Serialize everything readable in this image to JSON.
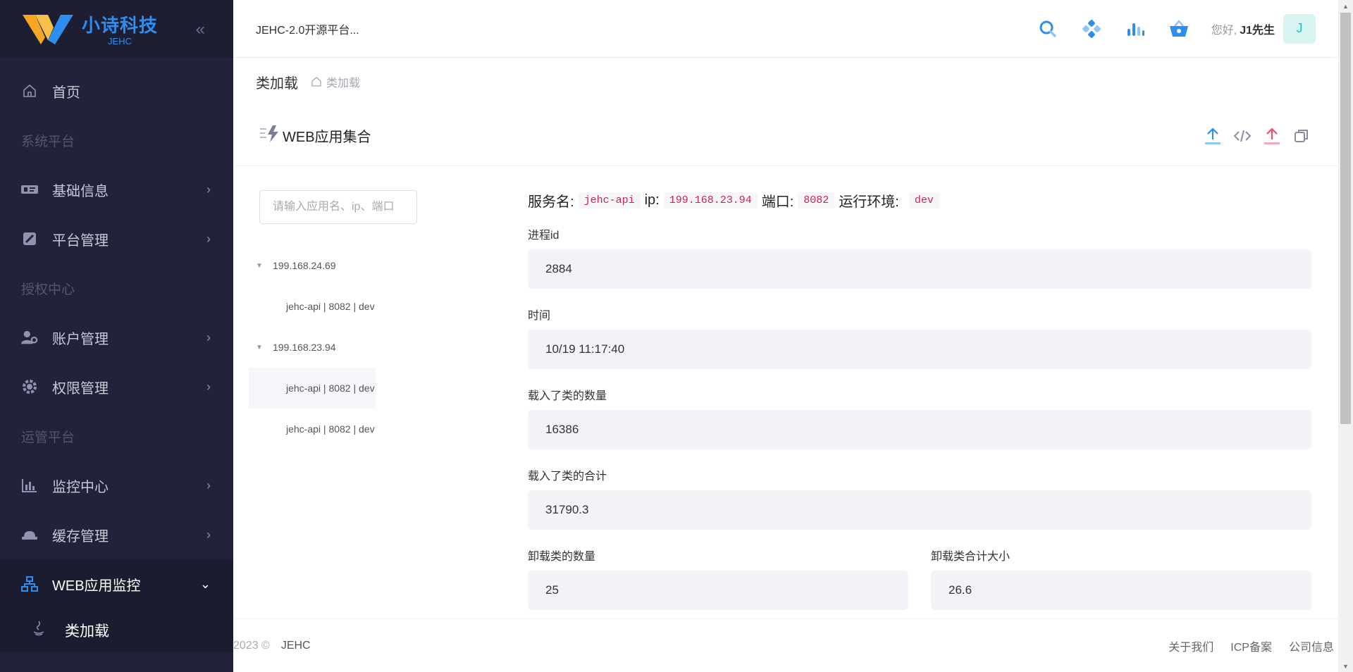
{
  "sidebar": {
    "logo": {
      "title": "小诗科技",
      "subtitle": "JEHC"
    },
    "home": "首页",
    "sections": {
      "system": "系统平台",
      "auth": "授权中心",
      "ops": "运管平台"
    },
    "items": {
      "basic": "基础信息",
      "platform": "平台管理",
      "account": "账户管理",
      "permission": "权限管理",
      "monitor": "监控中心",
      "cache": "缓存管理",
      "webapp": "WEB应用监控",
      "classload": "类加载"
    }
  },
  "header": {
    "title": "JEHC-2.0开源平台...",
    "greeting": "您好,",
    "username": "J1先生",
    "avatar": "J"
  },
  "breadcrumb": {
    "title": "类加载",
    "crumb": "类加载"
  },
  "card": {
    "title": "WEB应用集合",
    "search_placeholder": "请输入应用名、ip、端口",
    "tree": [
      {
        "label": "199.168.24.69",
        "children": [
          "jehc-api | 8082 | dev"
        ]
      },
      {
        "label": "199.168.23.94",
        "children": [
          "jehc-api | 8082 | dev",
          "jehc-api | 8082 | dev"
        ]
      }
    ]
  },
  "detail": {
    "service_label": "服务名:",
    "service": "jehc-api",
    "ip_label": "ip:",
    "ip": "199.168.23.94",
    "port_label": "端口:",
    "port": "8082",
    "env_label": "运行环境:",
    "env": "dev",
    "fields": {
      "pid_label": "进程id",
      "pid": "2884",
      "time_label": "时间",
      "time": "10/19 11:17:40",
      "loaded_count_label": "载入了类的数量",
      "loaded_count": "16386",
      "loaded_total_label": "载入了类的合计",
      "loaded_total": "31790.3",
      "unloaded_count_label": "卸载类的数量",
      "unloaded_count": "25",
      "unloaded_size_label": "卸载类合计大小",
      "unloaded_size": "26.6"
    }
  },
  "footer": {
    "copyright": "2023 ©",
    "brand": "JEHC",
    "links": [
      "关于我们",
      "ICP备案",
      "公司信息"
    ]
  },
  "colors": {
    "sidebar_bg": "#22223a",
    "accent": "#2b8ef0",
    "code_text": "#c7254e",
    "field_bg": "#f1f3f6"
  }
}
